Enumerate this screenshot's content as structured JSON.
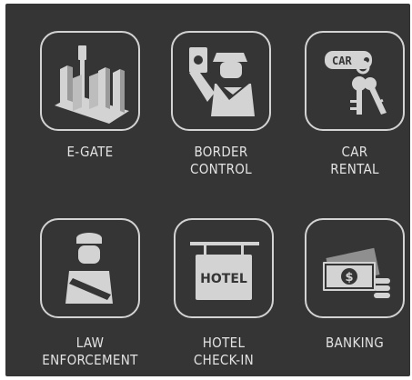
{
  "tiles": [
    {
      "id": "e-gate",
      "label": "E-GATE",
      "icon": "e-gate-icon"
    },
    {
      "id": "border-control",
      "label": "BORDER\nCONTROL",
      "icon": "border-control-officer-icon"
    },
    {
      "id": "car-rental",
      "label": "CAR\nRENTAL",
      "icon": "car-keys-icon",
      "icon_text": "CAR"
    },
    {
      "id": "law-enforcement",
      "label": "LAW\nENFORCEMENT",
      "icon": "police-officer-icon"
    },
    {
      "id": "hotel-check-in",
      "label": "HOTEL\nCHECK-IN",
      "icon": "hotel-sign-icon",
      "icon_text": "HOTEL"
    },
    {
      "id": "banking",
      "label": "BANKING",
      "icon": "money-stack-icon",
      "icon_text": "$"
    }
  ],
  "colors": {
    "background": "#353535",
    "icon": "#d3d3d3",
    "label": "#e3e3e3"
  }
}
